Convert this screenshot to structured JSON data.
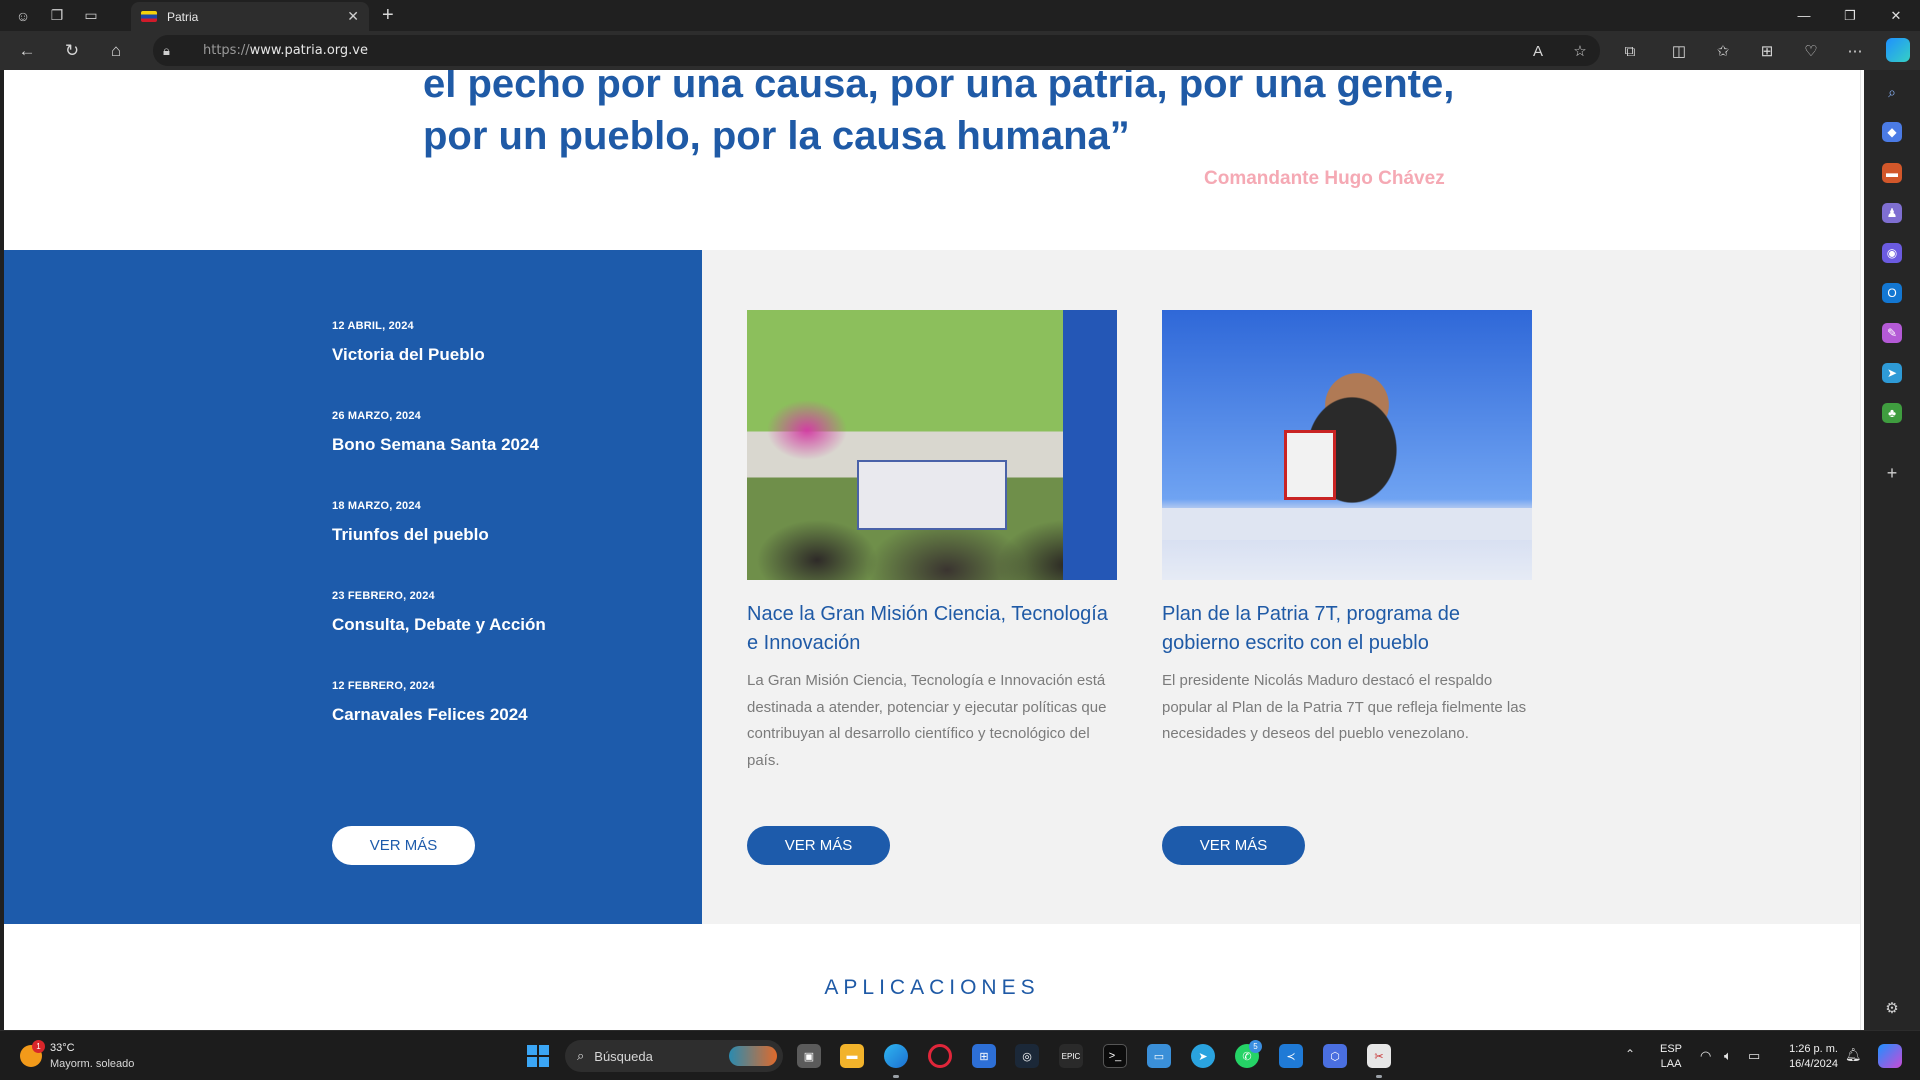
{
  "browser": {
    "tab_title": "Patria",
    "url_proto": "https://",
    "url_host": "www.patria.org.ve"
  },
  "page": {
    "quote_line1_a": "el pecho por una causa, por una ",
    "quote_line1_hl": "patria",
    "quote_line1_b": ", por una gente,",
    "quote_line2_a": "por un ",
    "quote_line2_hl": "pueblo",
    "quote_line2_b": ", por la causa humana”",
    "quote_author": "Comandante Hugo Chávez",
    "news": [
      {
        "date": "12 ABRIL, 2024",
        "title": "Victoria del Pueblo"
      },
      {
        "date": "26 MARZO, 2024",
        "title": "Bono Semana Santa 2024"
      },
      {
        "date": "18 MARZO, 2024",
        "title": "Triunfos del pueblo"
      },
      {
        "date": "23 FEBRERO, 2024",
        "title": "Consulta, Debate y Acción"
      },
      {
        "date": "12 FEBRERO, 2024",
        "title": "Carnavales Felices 2024"
      }
    ],
    "news_more_label": "VER MÁS",
    "cards": [
      {
        "title": "Nace la Gran Misión Ciencia, Tecnología e Innovación",
        "description": "La Gran Misión Ciencia, Tecnología e Innovación está destinada a atender, potenciar y ejecutar políticas que contribuyan al desarrollo científico y tecnológico del país.",
        "button": "VER MÁS"
      },
      {
        "title": "Plan de la Patria 7T, programa de gobierno escrito con el pueblo",
        "description": "El presidente Nicolás Maduro destacó el respaldo popular al Plan de la Patria 7T que refleja fielmente las necesidades y deseos del pueblo venezolano.",
        "button": "VER MÁS"
      }
    ],
    "section_heading": "APLICACIONES"
  },
  "taskbar": {
    "weather_temp": "33°C",
    "weather_condition": "Mayorm. soleado",
    "weather_badge": "1",
    "search_placeholder": "Búsqueda",
    "lang_line1": "ESP",
    "lang_line2": "LAA",
    "time": "1:26 p. m.",
    "date": "16/4/2024",
    "whatsapp_badge": "5"
  },
  "colors": {
    "brand_blue": "#1d5bab",
    "title_blue": "#1f5aa6",
    "author_pink": "#f5a9b4",
    "band_gray": "#f2f2f2"
  }
}
